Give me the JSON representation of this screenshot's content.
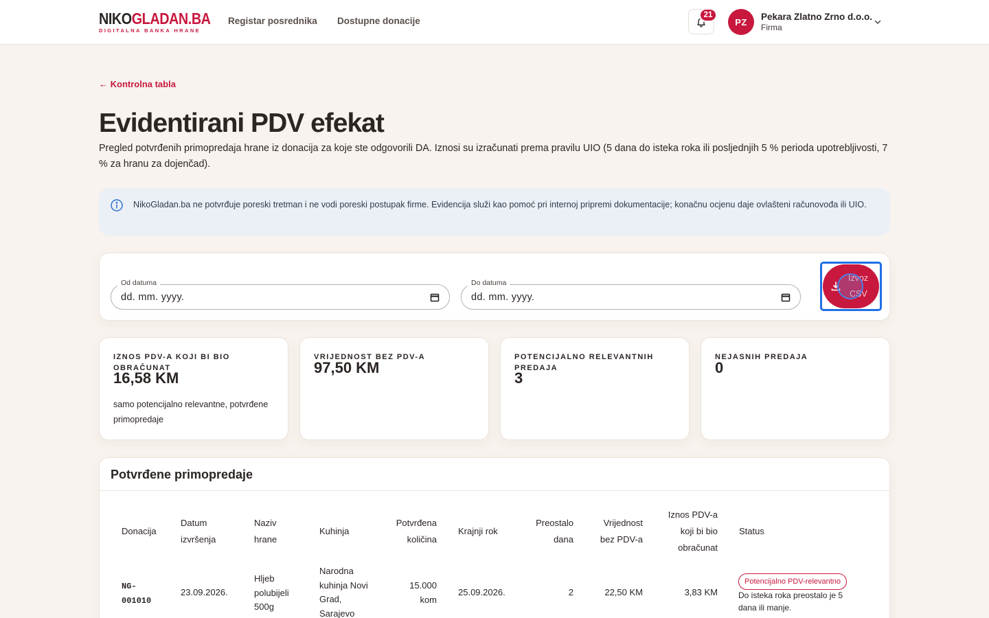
{
  "header": {
    "logo_main_a": "NIKO",
    "logo_main_b": "GLADAN",
    "logo_main_c": ".BA",
    "logo_sub": "DIGITALNA BANKA HRANE",
    "nav": [
      "Registar posrednika",
      "Dostupne donacije"
    ],
    "notifications_count": "21",
    "user": {
      "initials": "PZ",
      "name": "Pekara Zlatno Zrno d.o.o.",
      "role": "Firma"
    }
  },
  "page": {
    "back_link": "← Kontrolna tabla",
    "title": "Evidentirani PDV efekat",
    "lead": "Pregled potvrđenih primopredaja hrane iz donacija za koje ste odgovorili DA. Iznosi su izračunati prema pravilu UIO (5 dana do isteka roka ili posljednjih 5 % perioda upotrebljivosti, 7 % za hranu za dojenčad).",
    "info_text": "NikoGladan.ba ne potvrđuje poreski tretman i ne vodi poreski postupak firme. Evidencija služi kao pomoć pri internoj pripremi dokumentacije; konačnu ocjenu daje ovlašteni računovođa ili UIO."
  },
  "filters": {
    "from": {
      "label": "Od datuma",
      "value": "dd. mm. yyyy."
    },
    "to": {
      "label": "Do datuma",
      "value": "dd. mm. yyyy."
    },
    "export_line1": "Izvoz",
    "export_line2": "CSV"
  },
  "stats": [
    {
      "label": "IZNOS PDV-A KOJI BI BIO OBRAČUNAT",
      "value": "16,58 KM",
      "note": "samo potencijalno relevantne, potvrđene primopredaje"
    },
    {
      "label": "VRIJEDNOST BEZ PDV-A",
      "value": "97,50 KM",
      "note": ""
    },
    {
      "label": "POTENCIJALNO RELEVANTNIH PREDAJA",
      "value": "3",
      "note": ""
    },
    {
      "label": "NEJASNIH PREDAJA",
      "value": "0",
      "note": ""
    }
  ],
  "table": {
    "title": "Potvrđene primopredaje",
    "columns": [
      "Donacija",
      "Datum izvršenja",
      "Naziv hrane",
      "Kuhinja",
      "Potvrđena količina",
      "Krajnji rok",
      "Preostalo dana",
      "Vrijednost bez PDV-a",
      "Iznos PDV-a koji bi bio obračunat",
      "Status"
    ],
    "rows": [
      {
        "donation": "NG-001010",
        "date": "23.09.2026.",
        "food": "Hljeb polubijeli 500g",
        "kitchen": "Narodna kuhinja Novi Grad, Sarajevo",
        "qty": "15.000 kom",
        "deadline": "25.09.2026.",
        "days_left": "2",
        "value_net": "22,50 KM",
        "vat": "3,83 KM",
        "status": "Potencijalno PDV-relevantno",
        "status_note": "Do isteka roka preostalo je 5 dana ili manje."
      }
    ]
  },
  "colors": {
    "brand": "#c8183e",
    "page_bg": "#f8f3ee",
    "info_bg": "#ebf0f6",
    "focus": "#1f6fe6"
  }
}
